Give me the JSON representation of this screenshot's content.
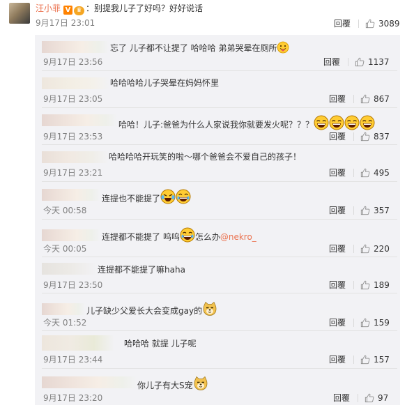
{
  "post": {
    "author": "汪小菲",
    "text": "：别提我儿子了好吗？好好说话",
    "time": "9月17日 23:01",
    "reply_label": "回覆",
    "likes": "3089"
  },
  "colors": {
    "accent": "#eb7350",
    "panel": "#f2f2f5",
    "time": "#808080",
    "vip": "#ff8200"
  },
  "comments": [
    {
      "text": "忘了 儿子都不让提了 哈哈哈 弟弟哭晕在厕所",
      "time": "9月17日 23:56",
      "reply_label": "回覆",
      "likes": "1137",
      "emojis": [
        "face-with-tongue"
      ]
    },
    {
      "text": "哈哈哈哈儿子哭晕在妈妈怀里",
      "time": "9月17日 23:05",
      "reply_label": "回覆",
      "likes": "867",
      "emojis": []
    },
    {
      "text": "哈哈！儿子:爸爸为什么人家说我你就要发火呢？？？",
      "time": "9月17日 23:53",
      "reply_label": "回覆",
      "likes": "837",
      "emojis": [
        "grinning-face",
        "grinning-face",
        "grinning-face",
        "grinning-face"
      ]
    },
    {
      "text": "哈哈哈哈开玩笑的啦～哪个爸爸会不爱自己的孩子！",
      "time": "9月17日 23:21",
      "reply_label": "回覆",
      "likes": "495",
      "emojis": []
    },
    {
      "text": "连提也不能提了",
      "time": "今天 00:58",
      "reply_label": "回覆",
      "likes": "357",
      "emojis": [
        "crying-laughing-face",
        "laughing-face"
      ]
    },
    {
      "text": "连提都不能提了 呜呜",
      "text2": "怎么办",
      "mention": "@nekro_",
      "time": "今天 00:05",
      "reply_label": "回覆",
      "likes": "220",
      "emojis": [
        "laughing-face"
      ]
    },
    {
      "text": "连提都不能提了嘛haha",
      "time": "9月17日 23:50",
      "reply_label": "回覆",
      "likes": "189",
      "emojis": []
    },
    {
      "text": "儿子缺少父爱长大会变成gay的",
      "time": "今天 01:52",
      "reply_label": "回覆",
      "likes": "159",
      "emojis": [
        "doge-face"
      ]
    },
    {
      "text": "哈哈哈 就提 儿子呢",
      "time": "9月17日 23:44",
      "reply_label": "回覆",
      "likes": "157",
      "emojis": []
    },
    {
      "text": "你儿子有大S宠",
      "time": "9月17日 23:20",
      "reply_label": "回覆",
      "likes": "97",
      "emojis": [
        "doge-face"
      ]
    }
  ]
}
